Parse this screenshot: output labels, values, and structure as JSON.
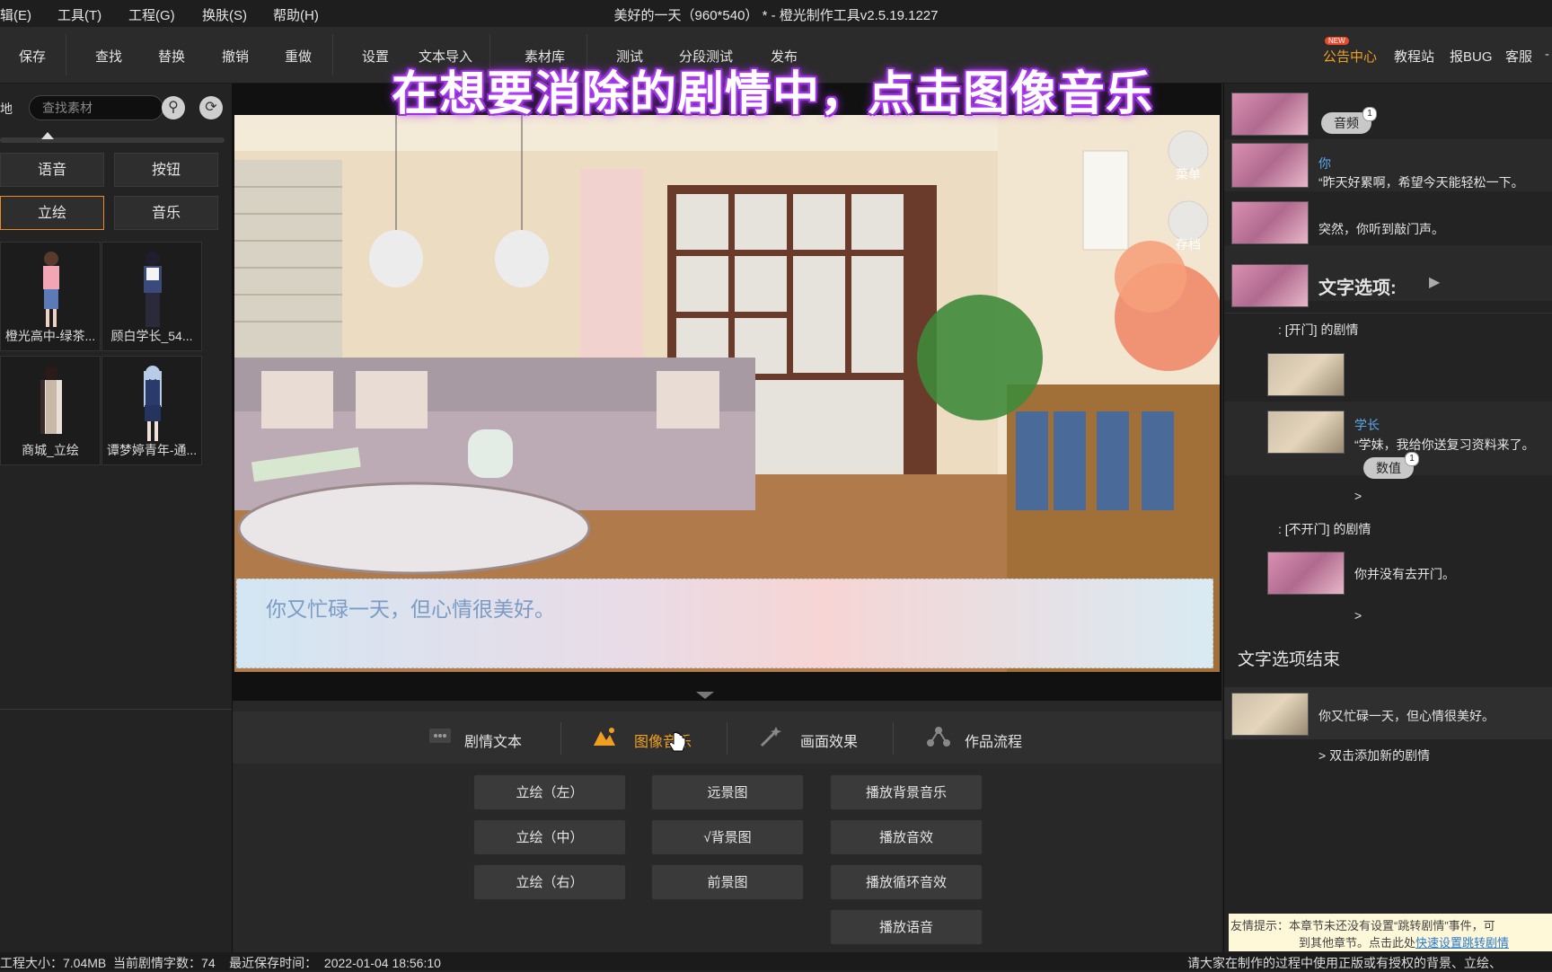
{
  "menu": [
    "辑(E)",
    "工具(T)",
    "工程(G)",
    "换肤(S)",
    "帮助(H)"
  ],
  "window_title": "美好的一天（960*540） * - 橙光制作工具v2.5.19.1227",
  "toolbar": {
    "save": "保存",
    "find": "查找",
    "replace": "替换",
    "undo": "撤销",
    "redo": "重做",
    "settings": "设置",
    "text_import": "文本导入",
    "assets": "素材库",
    "test": "测试",
    "segment_test": "分段测试",
    "publish": "发布",
    "notice": "公告中心",
    "new_badge": "NEW",
    "tutorial": "教程站",
    "report_bug": "报BUG",
    "support": "客服"
  },
  "caption": "在想要消除的剧情中，点击图像音乐",
  "left": {
    "side_char": "地",
    "search_placeholder": "查找素材",
    "categories": [
      "语音",
      "按钮",
      "立绘",
      "音乐"
    ],
    "active_category": "立绘",
    "assets": [
      "橙光高中-绿茶...",
      "顾白学长_54...",
      "商城_立绘",
      "谭梦婷青年-通..."
    ]
  },
  "stage": {
    "menu_label": "菜单",
    "save_label": "存档",
    "dialog_text": "你又忙碌一天，但心情很美好。"
  },
  "bottom_tabs": [
    "剧情文本",
    "图像音乐",
    "画面效果",
    "作品流程"
  ],
  "active_tab": "图像音乐",
  "actions": {
    "col1": [
      "立绘（左）",
      "立绘（中）",
      "立绘（右）"
    ],
    "col2": [
      "远景图",
      "√背景图",
      "前景图"
    ],
    "col3": [
      "播放背景音乐",
      "播放音效",
      "播放循环音效",
      "播放语音"
    ]
  },
  "story": {
    "audio_pill": "音频",
    "audio_count": "1",
    "speaker_you": "你",
    "line1": "“昨天好累啊，希望今天能轻松一下。",
    "line2": "突然，你听到敲门声。",
    "choice_title": "文字选项:",
    "branch1": ":  [开门] 的剧情",
    "speaker_senior": "学长",
    "line3": "“学妹，我给你送复习资料来了。",
    "value_pill": "数值",
    "value_count": "1",
    "arrow1": ">",
    "branch2": ":  [不开门] 的剧情",
    "line4": "你并没有去开门。",
    "arrow2": ">",
    "choice_end": "文字选项结束",
    "line5": "你又忙碌一天，但心情很美好。",
    "add_new": "> 双击添加新的剧情"
  },
  "tip": {
    "line1": "友情提示：本章节未还没有设置“跳转剧情”事件，可",
    "line2": "到其他章节。点击此处",
    "link": "快速设置跳转剧情"
  },
  "status": {
    "left": "工程大小：7.04MB  当前剧情字数：74    最近保存时间：  2022-01-04 18:56:10",
    "right": "请大家在制作的过程中使用正版或有授权的背景、立绘、"
  },
  "colors": {
    "accent": "#f0a020",
    "link": "#5aa8ec",
    "caption_glow": "#a030f0"
  }
}
